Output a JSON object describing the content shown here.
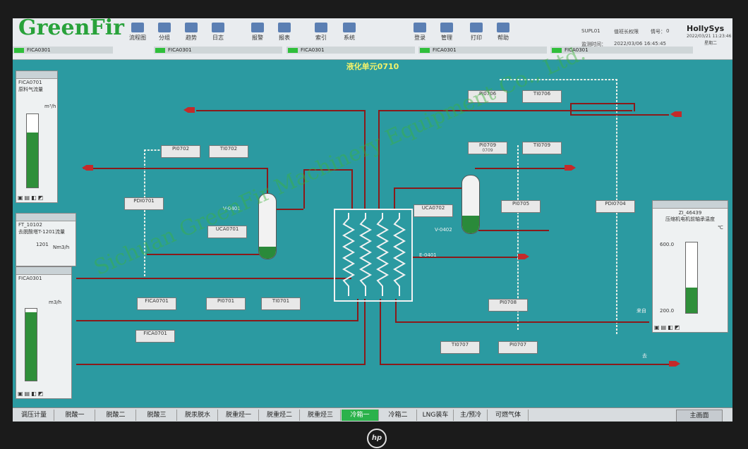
{
  "brand_watermark": "GreenFir",
  "vendor": "HollySys",
  "vendor_datetime": "2022/03/21 11:23:46",
  "vendor_weekday": "星期二",
  "toolbar": {
    "buttons": [
      "流程图",
      "分组",
      "趋势",
      "日志",
      "报警",
      "报表",
      "索引",
      "系统",
      "登录",
      "管理",
      "打印",
      "帮助"
    ],
    "info_id": "SUPL01",
    "info_role": "值班长权限",
    "info_no_label": "情号：",
    "info_no": "0",
    "info_time_label": "监测时间：",
    "info_time": "2022/03/06 16:45:45"
  },
  "status_tags": [
    "FICA0301",
    "FICA0301",
    "FICA0301",
    "FICA0301",
    "FICA0301"
  ],
  "screen_title": "液化单元0710",
  "tags": [
    {
      "id": "PI0706",
      "val": ""
    },
    {
      "id": "TI0706",
      "val": ""
    },
    {
      "id": "PI0709",
      "val": "0709"
    },
    {
      "id": "TI0709",
      "val": ""
    },
    {
      "id": "PI0702",
      "val": ""
    },
    {
      "id": "TI0702",
      "val": ""
    },
    {
      "id": "PDI0701",
      "val": ""
    },
    {
      "id": "UCA0701",
      "val": ""
    },
    {
      "id": "UCA0702",
      "val": ""
    },
    {
      "id": "PI0705",
      "val": ""
    },
    {
      "id": "PDI0704",
      "val": ""
    },
    {
      "id": "FICA0701",
      "val": ""
    },
    {
      "id": "PI0701",
      "val": ""
    },
    {
      "id": "TI0701",
      "val": ""
    },
    {
      "id": "FICA0701",
      "val": ""
    },
    {
      "id": "PI0708",
      "val": ""
    },
    {
      "id": "TI0707",
      "val": ""
    },
    {
      "id": "PI0707",
      "val": ""
    }
  ],
  "labels": {
    "v0401": "V-0401",
    "v0402": "V-0402",
    "e0401": "E-0401",
    "come": "来自",
    "go": "去"
  },
  "panels": {
    "p1": {
      "tag": "FICA0701",
      "desc": "原料气流量",
      "unit": "m³/h"
    },
    "p2": {
      "tag": "FT_10102",
      "desc": "去脱酸塔T-1201流量",
      "unit": "Nm3/h",
      "val": "1201"
    },
    "p3": {
      "tag": "FICA0301",
      "desc": "",
      "unit": "m3/h"
    },
    "p4": {
      "tag": "ZI_46439",
      "desc": "压缩机电机前轴承温度",
      "unit": "℃",
      "max": "600.0",
      "min": "200.0"
    }
  },
  "nav": {
    "items": [
      "调压计量",
      "脱酸一",
      "脱酸二",
      "脱酸三",
      "脱汞脱水",
      "脱重烃一",
      "脱重烃二",
      "脱重烃三",
      "冷箱一",
      "冷箱二",
      "LNG装车",
      "主/预冷",
      "可燃气体"
    ],
    "active_index": 8,
    "home": "主画面"
  },
  "watermark_text": "Sichuan GreenFir Machinery Equipment Co., Ltd.",
  "bezel_logo": "hp"
}
